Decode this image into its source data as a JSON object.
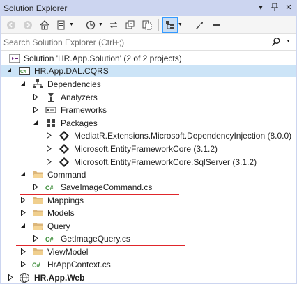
{
  "panel": {
    "title": "Solution Explorer"
  },
  "search": {
    "placeholder": "Search Solution Explorer (Ctrl+;)"
  },
  "tree": {
    "solution": "Solution 'HR.App.Solution' (2 of 2 projects)",
    "project_dal": "HR.App.DAL.CQRS",
    "dependencies": "Dependencies",
    "analyzers": "Analyzers",
    "frameworks": "Frameworks",
    "packages": "Packages",
    "pkg_mediatr": "MediatR.Extensions.Microsoft.DependencyInjection (8.0.0)",
    "pkg_ef": "Microsoft.EntityFrameworkCore (3.1.2)",
    "pkg_ef_sql": "Microsoft.EntityFrameworkCore.SqlServer (3.1.2)",
    "command": "Command",
    "save_image_command": "SaveImageCommand.cs",
    "mappings": "Mappings",
    "models": "Models",
    "query": "Query",
    "get_image_query": "GetImageQuery.cs",
    "viewmodel": "ViewModel",
    "hr_app_context": "HrAppContext.cs",
    "project_web": "HR.App.Web"
  },
  "colors": {
    "title_bg": "#ccd5f0",
    "selection": "#cce4f7",
    "annotation": "#e0262b",
    "folder": "#dcb67a",
    "csharp": "#388a34"
  }
}
